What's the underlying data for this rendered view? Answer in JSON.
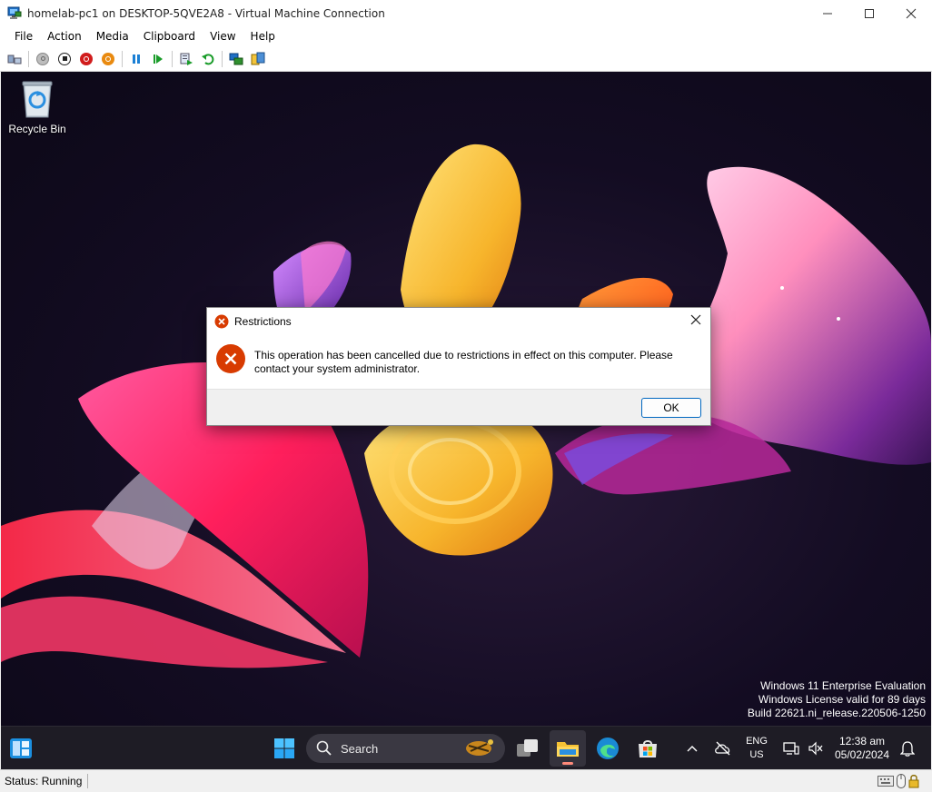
{
  "window": {
    "title": "homelab-pc1 on DESKTOP-5QVE2A8 - Virtual Machine Connection",
    "icon": "vm-monitor-icon"
  },
  "menu": {
    "items": [
      "File",
      "Action",
      "Media",
      "Clipboard",
      "View",
      "Help"
    ]
  },
  "toolbar": {
    "buttons": [
      "ctrl-alt-del",
      "start",
      "turn-off",
      "shut-down",
      "save",
      "pause",
      "resume",
      "checkpoint",
      "revert",
      "enhanced-session",
      "share"
    ]
  },
  "desktop": {
    "icons": [
      {
        "label": "Recycle Bin",
        "icon": "recycle-bin-icon"
      }
    ],
    "watermark": {
      "line1": "Windows 11 Enterprise Evaluation",
      "line2": "Windows License valid for 89 days",
      "line3": "Build 22621.ni_release.220506-1250"
    }
  },
  "dialog": {
    "title": "Restrictions",
    "message": "This operation has been cancelled due to restrictions in effect on this computer. Please contact your system administrator.",
    "ok_label": "OK",
    "colors": {
      "error": "#d83b01",
      "accent": "#0067c0"
    }
  },
  "taskbar": {
    "search_placeholder": "Search",
    "language_line1": "ENG",
    "language_line2": "US",
    "time": "12:38 am",
    "date": "05/02/2024"
  },
  "status": {
    "text": "Status: Running"
  }
}
